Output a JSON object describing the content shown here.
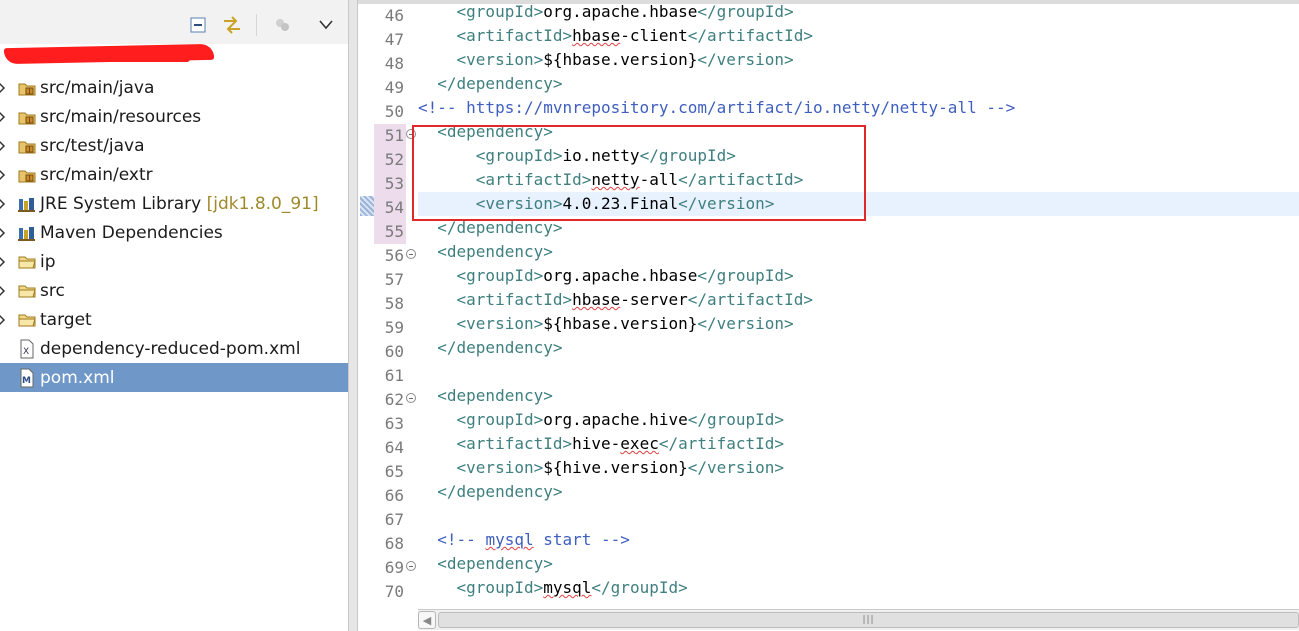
{
  "explorer": {
    "items": [
      {
        "label": "src/main/java",
        "icon": "package-folder-icon",
        "twisty": true
      },
      {
        "label": "src/main/resources",
        "icon": "package-folder-icon",
        "twisty": true
      },
      {
        "label": "src/test/java",
        "icon": "package-folder-icon",
        "twisty": true
      },
      {
        "label": "src/main/extr",
        "icon": "package-folder-icon",
        "twisty": true
      },
      {
        "label": "JRE System Library",
        "deco": "[jdk1.8.0_91]",
        "icon": "library-icon",
        "twisty": true
      },
      {
        "label": "Maven Dependencies",
        "icon": "library-icon",
        "twisty": true
      },
      {
        "label": "ip",
        "icon": "folder-icon",
        "twisty": true
      },
      {
        "label": "src",
        "icon": "folder-icon",
        "twisty": true
      },
      {
        "label": "target",
        "icon": "folder-icon",
        "twisty": true
      },
      {
        "label": "dependency-reduced-pom.xml",
        "icon": "xml-file-icon",
        "twisty": false
      },
      {
        "label": "pom.xml",
        "icon": "maven-file-icon",
        "twisty": false,
        "selected": true
      }
    ]
  },
  "editor": {
    "current_line": "54",
    "lines": [
      {
        "n": "46",
        "parts": [
          [
            "    ",
            ""
          ],
          [
            "<groupId>",
            "tag"
          ],
          [
            "org.apache.hbase",
            "txt"
          ],
          [
            "</groupId>",
            "tag"
          ]
        ]
      },
      {
        "n": "47",
        "parts": [
          [
            "    ",
            ""
          ],
          [
            "<artifactId>",
            "tag"
          ],
          [
            "hbase",
            "txt sq"
          ],
          [
            "-client",
            "txt"
          ],
          [
            "</artifactId>",
            "tag"
          ]
        ]
      },
      {
        "n": "48",
        "parts": [
          [
            "    ",
            ""
          ],
          [
            "<version>",
            "tag"
          ],
          [
            "${hbase.version}",
            "txt"
          ],
          [
            "</version>",
            "tag"
          ]
        ]
      },
      {
        "n": "49",
        "parts": [
          [
            "  ",
            ""
          ],
          [
            "</dependency>",
            "tag"
          ]
        ]
      },
      {
        "n": "50",
        "parts": [
          [
            "<!-- https://mvnrepository.com/artifact/io.netty/netty-all -->",
            "cmt"
          ]
        ]
      },
      {
        "n": "51",
        "fold": true,
        "parts": [
          [
            "  ",
            ""
          ],
          [
            "<dependency>",
            "tag"
          ]
        ]
      },
      {
        "n": "52",
        "parts": [
          [
            "      ",
            ""
          ],
          [
            "<groupId>",
            "tag"
          ],
          [
            "io.netty",
            "txt"
          ],
          [
            "</groupId>",
            "tag"
          ]
        ]
      },
      {
        "n": "53",
        "parts": [
          [
            "      ",
            ""
          ],
          [
            "<artifactId>",
            "tag"
          ],
          [
            "netty",
            "txt sq"
          ],
          [
            "-all",
            "txt"
          ],
          [
            "</artifactId>",
            "tag"
          ]
        ]
      },
      {
        "n": "54",
        "parts": [
          [
            "      ",
            ""
          ],
          [
            "<version>",
            "tag"
          ],
          [
            "4.0.23.Final",
            "txt"
          ],
          [
            "</version>",
            "tag"
          ]
        ]
      },
      {
        "n": "55",
        "parts": [
          [
            "  ",
            ""
          ],
          [
            "</dependency>",
            "tag"
          ]
        ]
      },
      {
        "n": "56",
        "fold": true,
        "parts": [
          [
            "  ",
            ""
          ],
          [
            "<dependency>",
            "tag"
          ]
        ]
      },
      {
        "n": "57",
        "parts": [
          [
            "    ",
            ""
          ],
          [
            "<groupId>",
            "tag"
          ],
          [
            "org.apache.hbase",
            "txt"
          ],
          [
            "</groupId>",
            "tag"
          ]
        ]
      },
      {
        "n": "58",
        "parts": [
          [
            "    ",
            ""
          ],
          [
            "<artifactId>",
            "tag"
          ],
          [
            "hbase",
            "txt sq"
          ],
          [
            "-server",
            "txt"
          ],
          [
            "</artifactId>",
            "tag"
          ]
        ]
      },
      {
        "n": "59",
        "parts": [
          [
            "    ",
            ""
          ],
          [
            "<version>",
            "tag"
          ],
          [
            "${hbase.version}",
            "txt"
          ],
          [
            "</version>",
            "tag"
          ]
        ]
      },
      {
        "n": "60",
        "parts": [
          [
            "  ",
            ""
          ],
          [
            "</dependency>",
            "tag"
          ]
        ]
      },
      {
        "n": "61",
        "parts": []
      },
      {
        "n": "62",
        "fold": true,
        "parts": [
          [
            "  ",
            ""
          ],
          [
            "<dependency>",
            "tag"
          ]
        ]
      },
      {
        "n": "63",
        "parts": [
          [
            "    ",
            ""
          ],
          [
            "<groupId>",
            "tag"
          ],
          [
            "org.apache.hive",
            "txt"
          ],
          [
            "</groupId>",
            "tag"
          ]
        ]
      },
      {
        "n": "64",
        "parts": [
          [
            "    ",
            ""
          ],
          [
            "<artifactId>",
            "tag"
          ],
          [
            "hive-",
            "txt"
          ],
          [
            "exec",
            "txt sq"
          ],
          [
            "</artifactId>",
            "tag"
          ]
        ]
      },
      {
        "n": "65",
        "parts": [
          [
            "    ",
            ""
          ],
          [
            "<version>",
            "tag"
          ],
          [
            "${hive.version}",
            "txt"
          ],
          [
            "</version>",
            "tag"
          ]
        ]
      },
      {
        "n": "66",
        "parts": [
          [
            "  ",
            ""
          ],
          [
            "</dependency>",
            "tag"
          ]
        ]
      },
      {
        "n": "67",
        "parts": []
      },
      {
        "n": "68",
        "parts": [
          [
            "  ",
            ""
          ],
          [
            "<!-- ",
            "cmt"
          ],
          [
            "mysql",
            "cmt sq"
          ],
          [
            " start -->",
            "cmt"
          ]
        ]
      },
      {
        "n": "69",
        "fold": true,
        "parts": [
          [
            "  ",
            ""
          ],
          [
            "<dependency>",
            "tag"
          ]
        ]
      },
      {
        "n": "70",
        "parts": [
          [
            "    ",
            ""
          ],
          [
            "<groupId>",
            "tag"
          ],
          [
            "mysql",
            "txt sq"
          ],
          [
            "</groupId>",
            "tag"
          ]
        ]
      }
    ]
  }
}
